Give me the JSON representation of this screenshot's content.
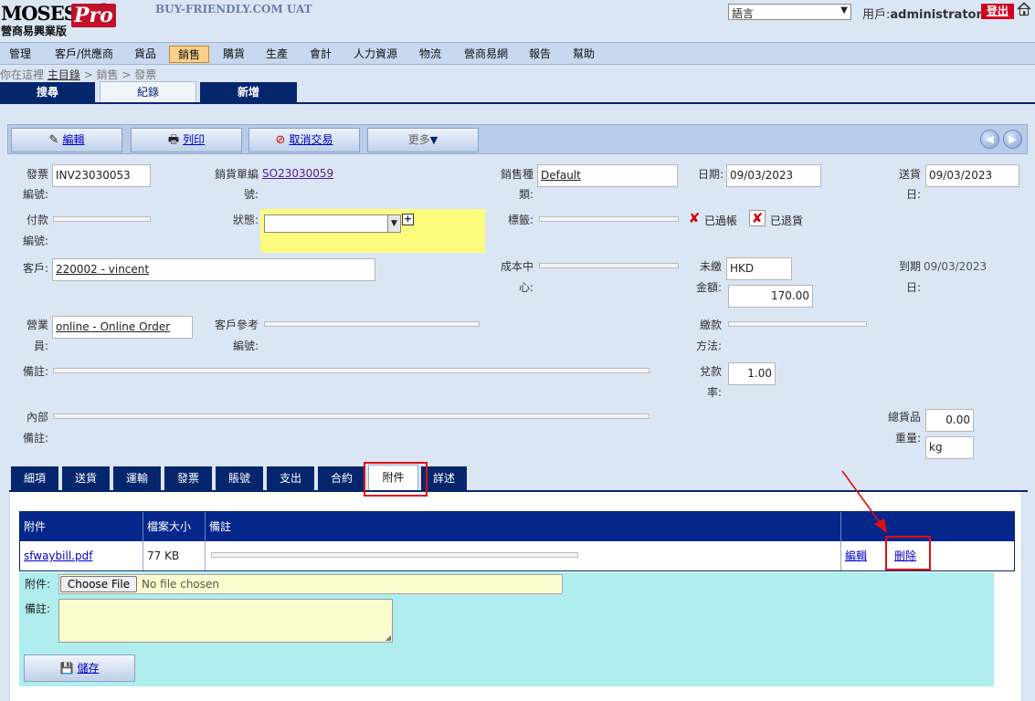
{
  "header": {
    "logo_text": "MOSES",
    "logo_pro": "Pro",
    "logo_sub": "營商易興業版",
    "site_title": "BUY-FRIENDLY.COM UAT",
    "language_select": "語言",
    "user_label": "用戶:",
    "user_name": "administrator",
    "logout_label": "登出"
  },
  "menu": [
    "管理",
    "客戶/供應商",
    "貨品",
    "銷售",
    "購貨",
    "生產",
    "會計",
    "人力資源",
    "物流",
    "營商易網",
    "報告",
    "幫助"
  ],
  "breadcrumb": {
    "prefix": "你在這裡",
    "home": "主目錄",
    "path": " > 銷售 > 發票"
  },
  "nav_tabs": [
    "搜尋",
    "紀錄",
    "新增"
  ],
  "toolbar": {
    "edit": "編輯",
    "print": "列印",
    "cancel": "取消交易",
    "more": "更多"
  },
  "form": {
    "invoice_no_label_1": "發票",
    "invoice_no_label_2": "編號:",
    "invoice_no": "INV23030053",
    "so_no_label_1": "銷貨單編",
    "so_no_label_2": "號:",
    "so_no": "SO23030059",
    "sales_type_label_1": "銷售種",
    "sales_type_label_2": "類:",
    "sales_type": "Default",
    "date_label": "日期:",
    "date": "09/03/2023",
    "ship_date_label_1": "送貨",
    "ship_date_label_2": "日:",
    "ship_date": "09/03/2023",
    "payment_no_label_1": "付款",
    "payment_no_label_2": "編號:",
    "status_label": "狀態:",
    "tag_label": "標籤:",
    "posted_label": "已過帳",
    "returned_label": "已退貨",
    "customer_label": "客戶:",
    "customer": "220002 - vincent",
    "cost_center_label_1": "成本中",
    "cost_center_label_2": "心:",
    "unpaid_label_1": "未繳",
    "unpaid_label_2": "金額:",
    "currency": "HKD",
    "unpaid_amount": "170.00",
    "due_date_label_1": "到期",
    "due_date_label_2": "日:",
    "due_date": "09/03/2023",
    "salesman_label_1": "營業",
    "salesman_label_2": "員:",
    "salesman": "online - Online Order",
    "cust_ref_label_1": "客戶參考",
    "cust_ref_label_2": "編號:",
    "pay_method_label_1": "繳款",
    "pay_method_label_2": "方法:",
    "remark_label": "備註:",
    "exrate_label_1": "兌款",
    "exrate_label_2": "率:",
    "exrate": "1.00",
    "internal_remark_label_1": "內部",
    "internal_remark_label_2": "備註:",
    "total_goods_label_1": "總貨品",
    "total_goods_label_2": "重量:",
    "total_weight": "0.00",
    "weight_unit": "kg"
  },
  "sub_tabs": [
    "細項",
    "送貨",
    "運輸",
    "發票",
    "賬號",
    "支出",
    "合約",
    "附件",
    "詳述"
  ],
  "attachments": {
    "columns": [
      "附件",
      "檔案大小",
      "備註",
      ""
    ],
    "rows": [
      {
        "file": "sfwaybill.pdf",
        "size": "77 KB",
        "edit": "編輯",
        "delete": "刪除"
      }
    ],
    "upload_label": "附件:",
    "choose_file": "Choose File",
    "no_file": "No file chosen",
    "remark_label": "備註:",
    "save": "儲存"
  }
}
